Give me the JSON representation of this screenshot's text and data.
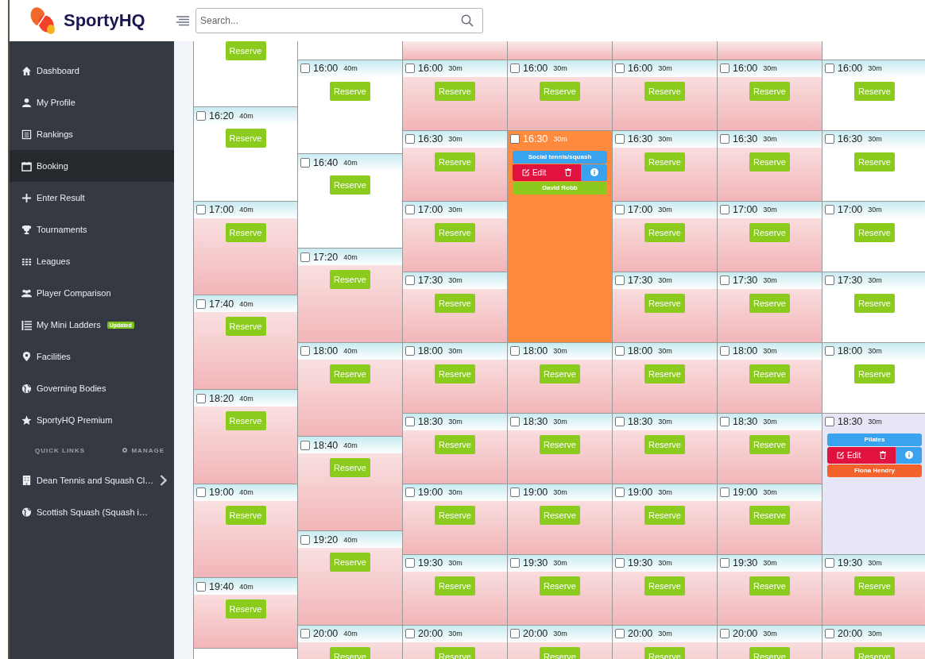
{
  "brand": {
    "name": "SportyHQ"
  },
  "search": {
    "placeholder": "Search..."
  },
  "sidebar": {
    "items": [
      {
        "label": "Dashboard",
        "selected": false
      },
      {
        "label": "My Profile",
        "selected": false
      },
      {
        "label": "Rankings",
        "selected": false
      },
      {
        "label": "Booking",
        "selected": true
      },
      {
        "label": "Enter Result",
        "selected": false
      },
      {
        "label": "Tournaments",
        "selected": false
      },
      {
        "label": "Leagues",
        "selected": false
      },
      {
        "label": "Player Comparison",
        "selected": false
      },
      {
        "label": "My Mini Ladders",
        "selected": false,
        "badge": "Updated"
      },
      {
        "label": "Facilities",
        "selected": false
      },
      {
        "label": "Governing Bodies",
        "selected": false
      },
      {
        "label": "SportyHQ Premium",
        "selected": false
      }
    ],
    "quick_links_heading": "QUICK LINKS",
    "manage_link": "MANAGE",
    "quick_links": [
      {
        "label": "Dean Tennis and Squash Cl…",
        "expandable": true
      },
      {
        "label": "Scottish Squash (Squash i…",
        "expandable": false
      }
    ]
  },
  "schedule": {
    "columns": [
      {
        "top": {
          "kind": "offpeak",
          "button": "Reserve"
        },
        "cells": [
          {
            "time": "16:20",
            "duration": "40m",
            "kind": "offpeak",
            "checked": false,
            "button": "Reserve"
          },
          {
            "time": "17:00",
            "duration": "40m",
            "kind": "peak",
            "checked": false,
            "button": "Reserve"
          },
          {
            "time": "17:40",
            "duration": "40m",
            "kind": "peak",
            "checked": false,
            "button": "Reserve"
          },
          {
            "time": "18:20",
            "duration": "40m",
            "kind": "peak",
            "checked": false,
            "button": "Reserve"
          },
          {
            "time": "19:00",
            "duration": "40m",
            "kind": "peak",
            "checked": false,
            "button": "Reserve"
          },
          {
            "time": "19:40",
            "duration": "40m",
            "kind": "peak",
            "checked": false,
            "button": "Reserve"
          }
        ]
      },
      {
        "top": {
          "kind": "offpeak"
        },
        "cells": [
          {
            "time": "16:00",
            "duration": "40m",
            "kind": "offpeak",
            "checked": false,
            "button": "Reserve"
          },
          {
            "time": "16:40",
            "duration": "40m",
            "kind": "offpeak",
            "checked": false,
            "button": "Reserve"
          },
          {
            "time": "17:20",
            "duration": "40m",
            "kind": "peak",
            "checked": false,
            "button": "Reserve"
          },
          {
            "time": "18:00",
            "duration": "40m",
            "kind": "peak",
            "checked": false,
            "button": "Reserve"
          },
          {
            "time": "18:40",
            "duration": "40m",
            "kind": "peak",
            "checked": false,
            "button": "Reserve"
          },
          {
            "time": "19:20",
            "duration": "40m",
            "kind": "peak",
            "checked": false,
            "button": "Reserve"
          },
          {
            "time": "20:00",
            "duration": "40m",
            "kind": "peak",
            "checked": false,
            "button": "Reserve"
          }
        ]
      },
      {
        "top": {
          "kind": "peak"
        },
        "cells": [
          {
            "time": "16:00",
            "duration": "30m",
            "kind": "peak",
            "checked": false,
            "button": "Reserve"
          },
          {
            "time": "16:30",
            "duration": "30m",
            "kind": "peak",
            "checked": false,
            "button": "Reserve"
          },
          {
            "time": "17:00",
            "duration": "30m",
            "kind": "peak",
            "checked": false,
            "button": "Reserve"
          },
          {
            "time": "17:30",
            "duration": "30m",
            "kind": "peak",
            "checked": false,
            "button": "Reserve"
          },
          {
            "time": "18:00",
            "duration": "30m",
            "kind": "peak",
            "checked": false,
            "button": "Reserve"
          },
          {
            "time": "18:30",
            "duration": "30m",
            "kind": "peak",
            "checked": false,
            "button": "Reserve"
          },
          {
            "time": "19:00",
            "duration": "30m",
            "kind": "peak",
            "checked": false,
            "button": "Reserve"
          },
          {
            "time": "19:30",
            "duration": "30m",
            "kind": "peak",
            "checked": false,
            "button": "Reserve"
          },
          {
            "time": "20:00",
            "duration": "30m",
            "kind": "peak",
            "checked": false,
            "button": "Reserve"
          }
        ]
      },
      {
        "top": {
          "kind": "peak"
        },
        "cells": [
          {
            "time": "16:00",
            "duration": "30m",
            "kind": "peak",
            "checked": false,
            "button": "Reserve"
          },
          {
            "time": "16:30",
            "duration": "30m",
            "kind": "booked",
            "color": "#ff8a3d",
            "checked": false,
            "activity": "Social tennis/squash",
            "edit": "Edit",
            "player": {
              "name": "David Robb",
              "color": "#8cc91f"
            }
          },
          {
            "time": "18:00",
            "duration": "30m",
            "kind": "peak",
            "checked": false,
            "button": "Reserve"
          },
          {
            "time": "18:30",
            "duration": "30m",
            "kind": "peak",
            "checked": false,
            "button": "Reserve"
          },
          {
            "time": "19:00",
            "duration": "30m",
            "kind": "peak",
            "checked": false,
            "button": "Reserve"
          },
          {
            "time": "19:30",
            "duration": "30m",
            "kind": "peak",
            "checked": false,
            "button": "Reserve"
          },
          {
            "time": "20:00",
            "duration": "30m",
            "kind": "peak",
            "checked": false,
            "button": "Reserve"
          }
        ]
      },
      {
        "top": {
          "kind": "peak"
        },
        "cells": [
          {
            "time": "16:00",
            "duration": "30m",
            "kind": "peak",
            "checked": false,
            "button": "Reserve"
          },
          {
            "time": "16:30",
            "duration": "30m",
            "kind": "peak",
            "checked": false,
            "button": "Reserve"
          },
          {
            "time": "17:00",
            "duration": "30m",
            "kind": "peak",
            "checked": false,
            "button": "Reserve"
          },
          {
            "time": "17:30",
            "duration": "30m",
            "kind": "peak",
            "checked": false,
            "button": "Reserve"
          },
          {
            "time": "18:00",
            "duration": "30m",
            "kind": "peak",
            "checked": false,
            "button": "Reserve"
          },
          {
            "time": "18:30",
            "duration": "30m",
            "kind": "peak",
            "checked": false,
            "button": "Reserve"
          },
          {
            "time": "19:00",
            "duration": "30m",
            "kind": "peak",
            "checked": false,
            "button": "Reserve"
          },
          {
            "time": "19:30",
            "duration": "30m",
            "kind": "peak",
            "checked": false,
            "button": "Reserve"
          },
          {
            "time": "20:00",
            "duration": "30m",
            "kind": "peak",
            "checked": false,
            "button": "Reserve"
          }
        ]
      },
      {
        "top": {
          "kind": "peak"
        },
        "cells": [
          {
            "time": "16:00",
            "duration": "30m",
            "kind": "peak",
            "checked": false,
            "button": "Reserve"
          },
          {
            "time": "16:30",
            "duration": "30m",
            "kind": "peak",
            "checked": false,
            "button": "Reserve"
          },
          {
            "time": "17:00",
            "duration": "30m",
            "kind": "peak",
            "checked": false,
            "button": "Reserve"
          },
          {
            "time": "17:30",
            "duration": "30m",
            "kind": "peak",
            "checked": false,
            "button": "Reserve"
          },
          {
            "time": "18:00",
            "duration": "30m",
            "kind": "peak",
            "checked": false,
            "button": "Reserve"
          },
          {
            "time": "18:30",
            "duration": "30m",
            "kind": "peak",
            "checked": false,
            "button": "Reserve"
          },
          {
            "time": "19:00",
            "duration": "30m",
            "kind": "peak",
            "checked": false,
            "button": "Reserve"
          },
          {
            "time": "19:30",
            "duration": "30m",
            "kind": "peak",
            "checked": false,
            "button": "Reserve"
          },
          {
            "time": "20:00",
            "duration": "30m",
            "kind": "peak",
            "checked": false,
            "button": "Reserve"
          }
        ]
      },
      {
        "top": {
          "kind": "offpeak"
        },
        "cells": [
          {
            "time": "16:00",
            "duration": "30m",
            "kind": "offpeak",
            "checked": false,
            "button": "Reserve"
          },
          {
            "time": "16:30",
            "duration": "30m",
            "kind": "offpeak",
            "checked": false,
            "button": "Reserve"
          },
          {
            "time": "17:00",
            "duration": "30m",
            "kind": "offpeak",
            "checked": false,
            "button": "Reserve"
          },
          {
            "time": "17:30",
            "duration": "30m",
            "kind": "offpeak",
            "checked": false,
            "button": "Reserve"
          },
          {
            "time": "18:00",
            "duration": "30m",
            "kind": "offpeak",
            "checked": false,
            "button": "Reserve"
          },
          {
            "time": "18:30",
            "duration": "30m",
            "kind": "booked",
            "color": "#e6e6f6",
            "checked": false,
            "activity": "Pilates",
            "edit": "Edit",
            "player": {
              "name": "Fiona Hendry",
              "color": "#f2622a"
            }
          },
          {
            "time": "19:30",
            "duration": "30m",
            "kind": "peak",
            "checked": false,
            "button": "Reserve"
          },
          {
            "time": "20:00",
            "duration": "30m",
            "kind": "peak",
            "checked": false,
            "button": "Reserve"
          }
        ]
      }
    ]
  }
}
